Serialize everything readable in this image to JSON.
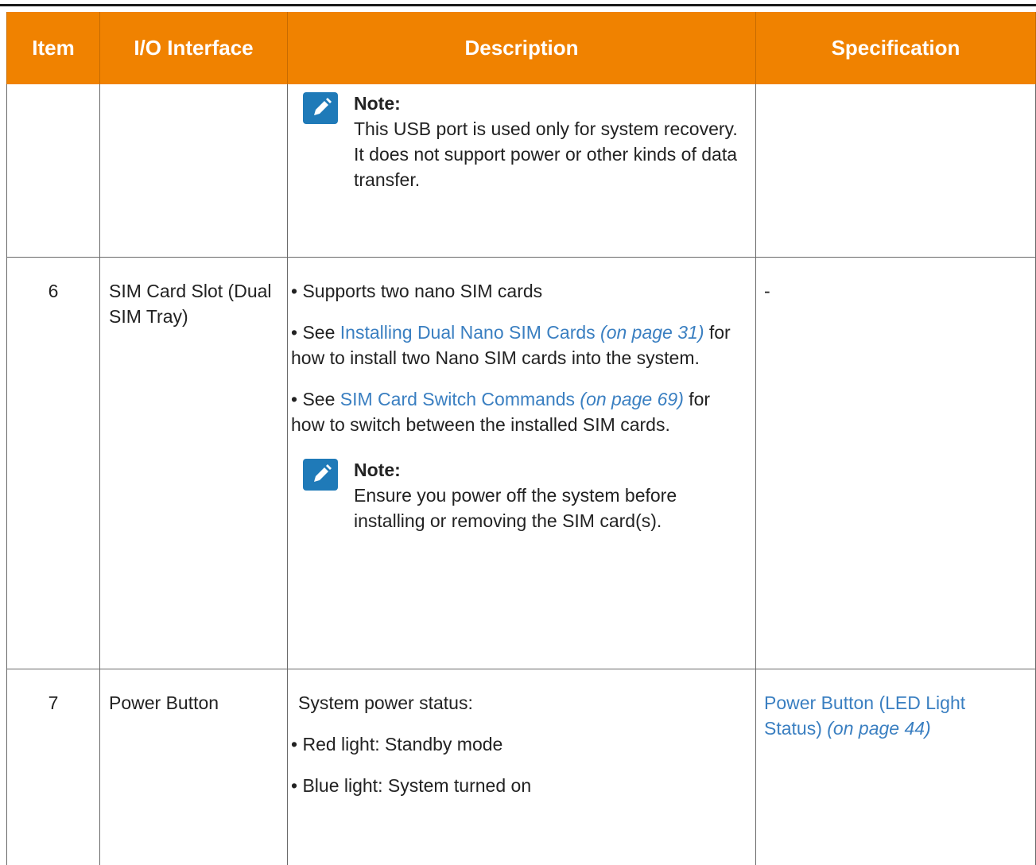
{
  "columns": {
    "item": "Item",
    "io_interface": "I/O Interface",
    "description": "Description",
    "specification": "Specification"
  },
  "row_usb": {
    "note_title": "Note:",
    "note_text": "This USB port is used only for system recovery. It does not support power or other kinds of data transfer."
  },
  "row_sim": {
    "item": "6",
    "interface": "SIM Card Slot (Dual SIM Tray)",
    "bullet_char": "•",
    "bullet1": "Supports two nano SIM cards",
    "bullet2_prefix": "See",
    "bullet2_link": "Installing Dual Nano SIM Cards",
    "bullet2_page": "(on page 31)",
    "bullet2_suffix": "for how to install two Nano SIM cards into the system.",
    "bullet3_prefix": "See",
    "bullet3_link": "SIM Card Switch Commands",
    "bullet3_page": "(on page 69)",
    "bullet3_suffix": "for how to switch between the installed SIM cards.",
    "note_title": "Note:",
    "note_text": "Ensure you power off the system before installing or removing the SIM card(s).",
    "spec": "-"
  },
  "row_power": {
    "item": "7",
    "interface": "Power Button",
    "intro": "System power status:",
    "bullet_char": "•",
    "bullet1": "Red light: Standby mode",
    "bullet2": "Blue light: System turned on",
    "spec_link": "Power Button (LED Light Status)",
    "spec_page": "(on page 44)"
  },
  "colors": {
    "header_bg": "#f08200",
    "header_text": "#ffffff",
    "link": "#3a7fc1",
    "note_icon": "#1f7ab8",
    "border": "#6a6a6a"
  },
  "icons": {
    "note": "pencil-icon"
  }
}
